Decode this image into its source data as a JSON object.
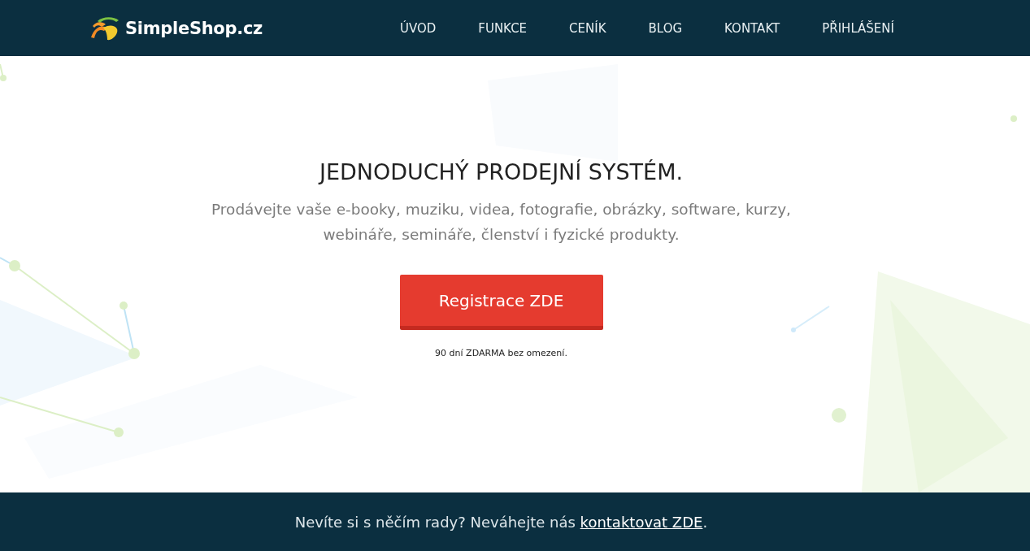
{
  "header": {
    "logo_text": "SimpleShop.cz",
    "nav": [
      {
        "label": "ÚVOD"
      },
      {
        "label": "FUNKCE"
      },
      {
        "label": "CENÍK"
      },
      {
        "label": "BLOG"
      },
      {
        "label": "KONTAKT"
      },
      {
        "label": "PŘIHLÁŠENÍ"
      }
    ]
  },
  "hero": {
    "title": "JEDNODUCHÝ PRODEJNÍ SYSTÉM.",
    "subtitle": "Prodávejte vaše e-booky, muziku, videa, fotografie, obrázky, software, kurzy, webináře, semináře, členství i fyzické produkty.",
    "cta_button": "Registrace ZDE",
    "note": "90 dní ZDARMA bez omezení."
  },
  "footer": {
    "text": "Nevíte si s něčím rady? Neváhejte nás",
    "link": "kontaktovat ZDE",
    "text_after": "."
  }
}
